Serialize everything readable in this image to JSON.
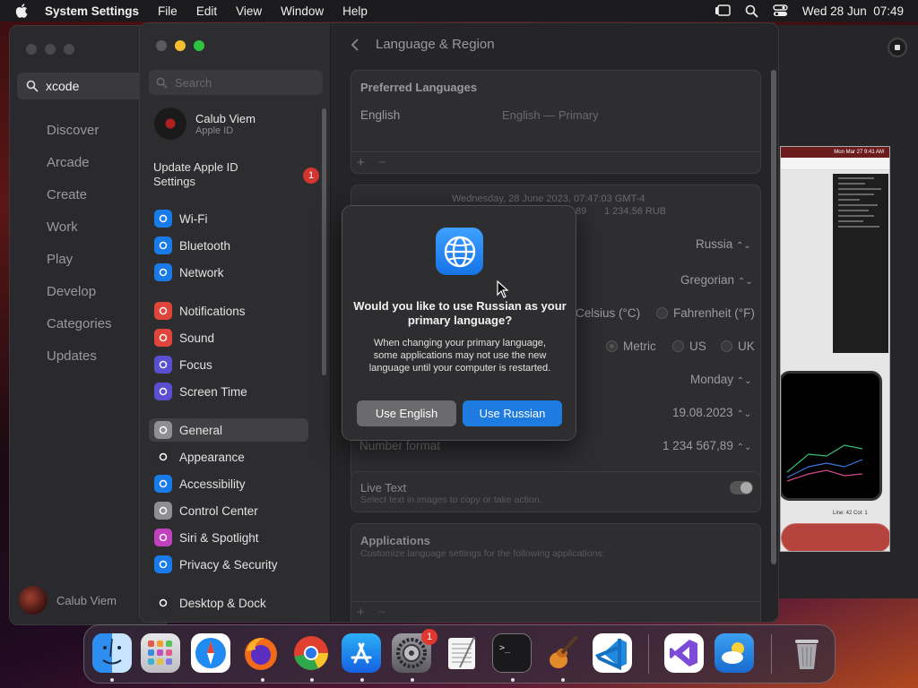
{
  "menubar": {
    "app_name": "System Settings",
    "menus": [
      "File",
      "Edit",
      "View",
      "Window",
      "Help"
    ],
    "datetime": "Wed 28 Jun  07:49"
  },
  "appstore": {
    "search_value": "xcode",
    "nav": [
      "Discover",
      "Arcade",
      "Create",
      "Work",
      "Play",
      "Develop",
      "Categories",
      "Updates"
    ],
    "user_name": "Calub Viem"
  },
  "thumbnail": {
    "menubar_clock": "Mon Mar 27  9:41 AM",
    "status_text": "Line: 42  Col: 1"
  },
  "settings": {
    "search_placeholder": "Search",
    "user_name": "Calub Viem",
    "user_sub": "Apple ID",
    "update_label": "Update Apple ID Settings",
    "update_badge": "1",
    "sidebar_items": [
      {
        "label": "Wi-Fi",
        "icon": "wifi-icon",
        "color": "#1a7ae8"
      },
      {
        "label": "Bluetooth",
        "icon": "bluetooth-icon",
        "color": "#1a7ae8"
      },
      {
        "label": "Network",
        "icon": "globe-icon",
        "color": "#1a7ae8"
      },
      {
        "label": "Notifications",
        "icon": "bell-icon",
        "color": "#e0453c"
      },
      {
        "label": "Sound",
        "icon": "speaker-icon",
        "color": "#e0453c"
      },
      {
        "label": "Focus",
        "icon": "moon-icon",
        "color": "#5a4fd0"
      },
      {
        "label": "Screen Time",
        "icon": "hourglass-icon",
        "color": "#5a4fd0"
      },
      {
        "label": "General",
        "icon": "gear-icon",
        "color": "#8e8e93"
      },
      {
        "label": "Appearance",
        "icon": "appearance-icon",
        "color": "#2c2c2e"
      },
      {
        "label": "Accessibility",
        "icon": "accessibility-icon",
        "color": "#1a7ae8"
      },
      {
        "label": "Control Center",
        "icon": "control-center-icon",
        "color": "#8e8e93"
      },
      {
        "label": "Siri & Spotlight",
        "icon": "siri-icon",
        "color": "#c040c0"
      },
      {
        "label": "Privacy & Security",
        "icon": "hand-icon",
        "color": "#1a7ae8"
      },
      {
        "label": "Desktop & Dock",
        "icon": "desktop-icon",
        "color": "#2c2c2e"
      }
    ],
    "page_title": "Language & Region",
    "preferred_languages_title": "Preferred Languages",
    "language_name": "English",
    "language_detail": "English — Primary",
    "date_preview": "Wednesday, 28 June 2023, 07:47:03 GMT-4",
    "number_preview_partial": "89",
    "currency_preview": "1 234,56 RUB",
    "region_value": "Russia",
    "calendar_value": "Gregorian",
    "temperature_options": [
      "Celsius (°C)",
      "Fahrenheit (°F)"
    ],
    "measurement_options": [
      "Metric",
      "US",
      "UK"
    ],
    "first_day_value": "Monday",
    "date_format_value": "19.08.2023",
    "number_format_label": "Number format",
    "number_format_value": "1 234 567,89",
    "live_text_title": "Live Text",
    "live_text_sub": "Select text in images to copy or take action.",
    "applications_title": "Applications",
    "applications_sub": "Customize language settings for the following applications:"
  },
  "dialog": {
    "title": "Would you like to use Russian as your primary language?",
    "message": "When changing your primary language, some applications may not use the new language until your computer is restarted.",
    "button_secondary": "Use English",
    "button_primary": "Use Russian"
  },
  "dock": {
    "settings_badge": "1"
  }
}
